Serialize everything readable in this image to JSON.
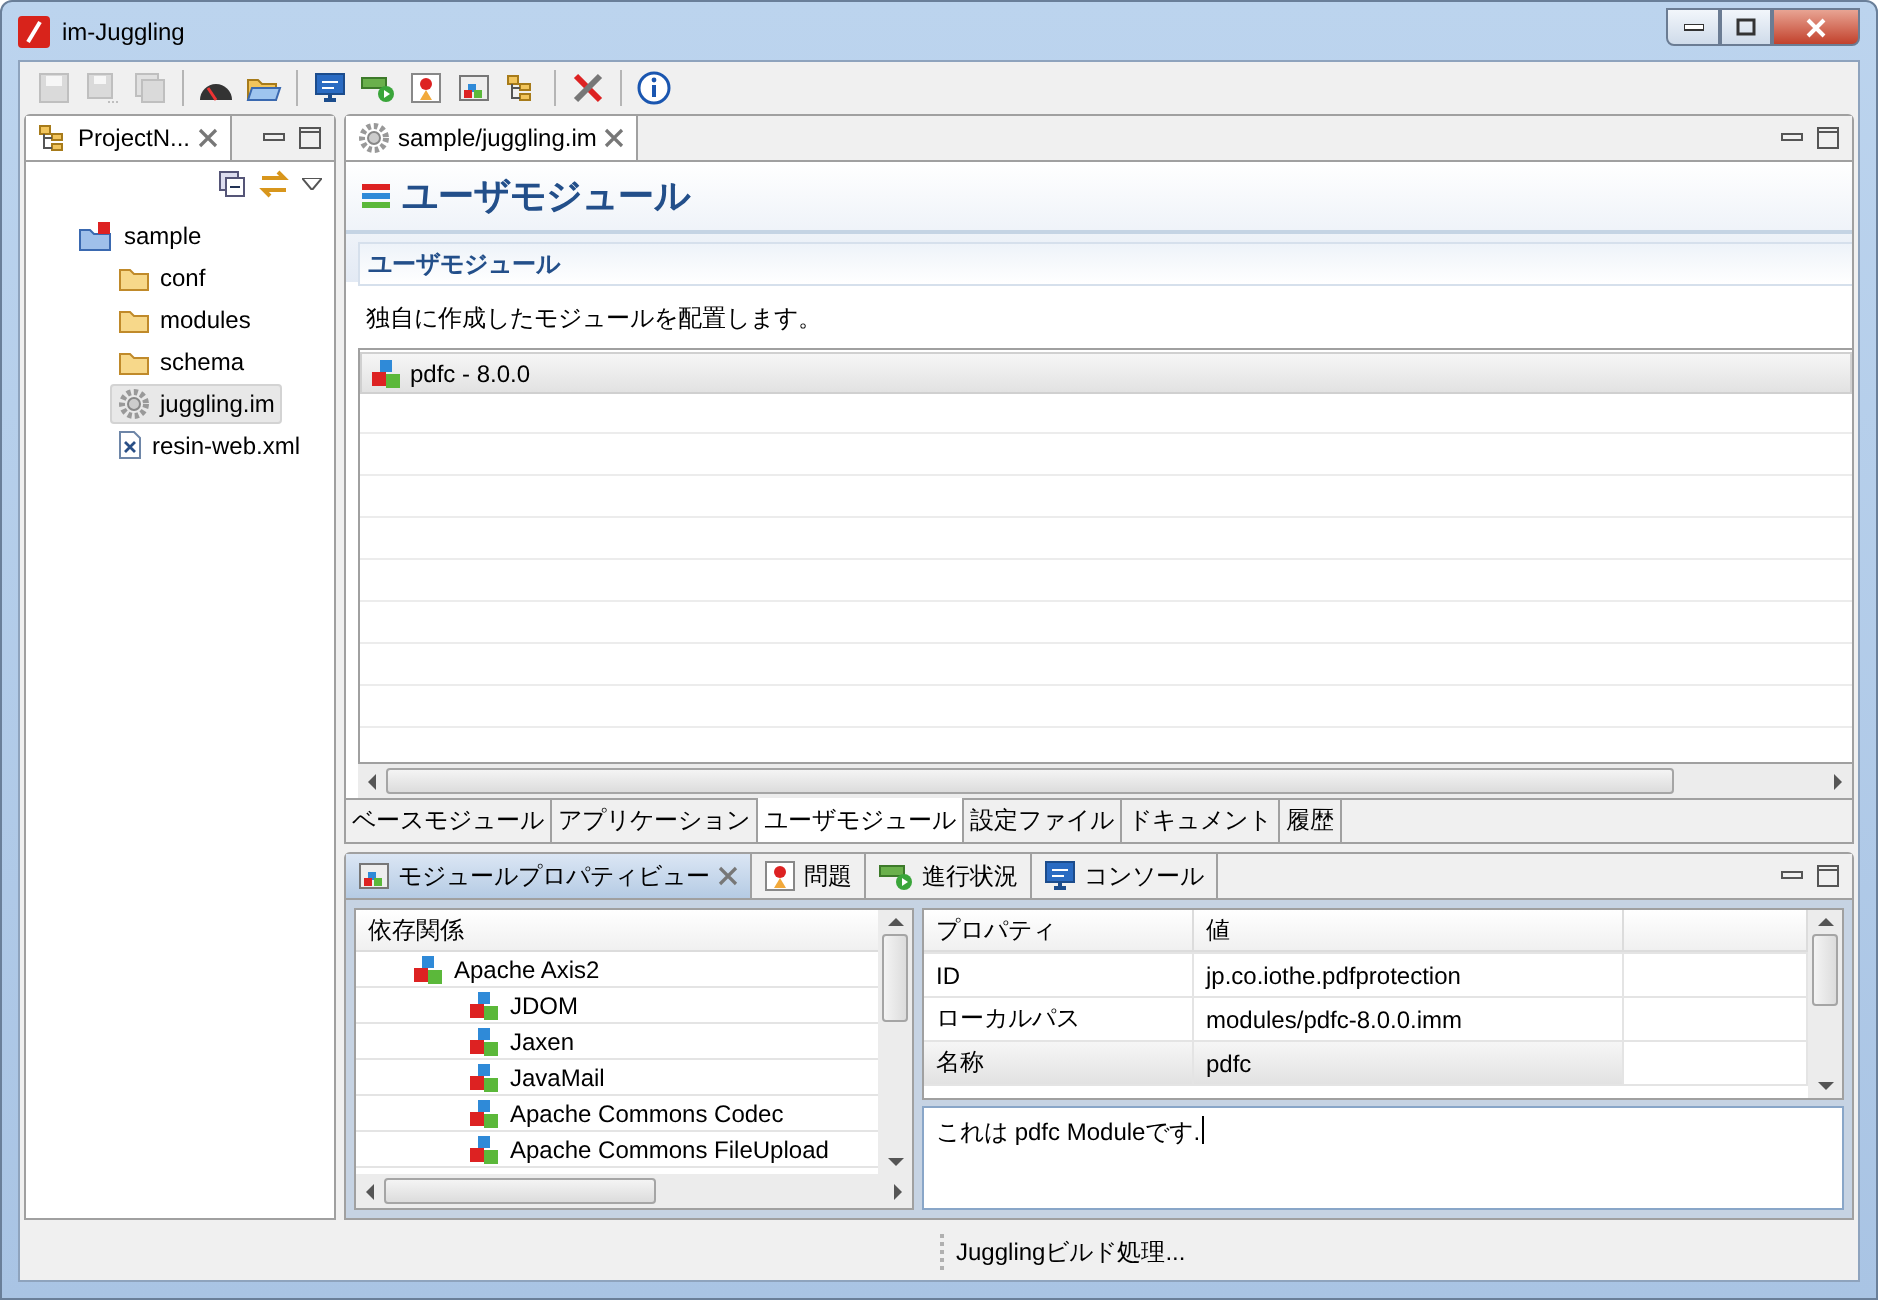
{
  "window": {
    "title": "im-Juggling"
  },
  "toolbar": [
    {
      "kind": "save",
      "disabled": true
    },
    {
      "kind": "save-as",
      "disabled": true
    },
    {
      "kind": "save-all",
      "disabled": true
    },
    {
      "kind": "gauge",
      "disabled": false
    },
    {
      "kind": "open-folder",
      "disabled": false
    },
    {
      "kind": "monitor",
      "disabled": false
    },
    {
      "kind": "run",
      "disabled": false
    },
    {
      "kind": "report",
      "disabled": false
    },
    {
      "kind": "window",
      "disabled": false
    },
    {
      "kind": "tree",
      "disabled": false
    },
    {
      "kind": "tools",
      "disabled": false
    },
    {
      "kind": "info",
      "disabled": false
    }
  ],
  "project_panel": {
    "tab": "ProjectN...",
    "tree": [
      {
        "label": "sample",
        "kind": "project",
        "selected": false,
        "children": [
          {
            "label": "conf",
            "kind": "folder",
            "selected": false
          },
          {
            "label": "modules",
            "kind": "folder",
            "selected": false
          },
          {
            "label": "schema",
            "kind": "folder",
            "selected": false
          },
          {
            "label": "juggling.im",
            "kind": "config",
            "selected": true
          },
          {
            "label": "resin-web.xml",
            "kind": "xml",
            "selected": false
          }
        ]
      }
    ]
  },
  "editor": {
    "tab": "sample/juggling.im",
    "heading": "ユーザモジュール",
    "section_title": "ユーザモジュール",
    "description": "独自に作成したモジュールを配置します。",
    "modules": [
      {
        "label": "pdfc - 8.0.0",
        "selected": true
      }
    ],
    "page_tabs": [
      {
        "label": "ベースモジュール",
        "selected": false
      },
      {
        "label": "アプリケーション",
        "selected": false
      },
      {
        "label": "ユーザモジュール",
        "selected": true
      },
      {
        "label": "設定ファイル",
        "selected": false
      },
      {
        "label": "ドキュメント",
        "selected": false
      },
      {
        "label": "履歴",
        "selected": false
      }
    ]
  },
  "bottom_panel": {
    "tabs": [
      {
        "label": "モジュールプロパティビュー",
        "kind": "module",
        "selected": true
      },
      {
        "label": "問題",
        "kind": "report",
        "selected": false
      },
      {
        "label": "進行状況",
        "kind": "run",
        "selected": false
      },
      {
        "label": "コンソール",
        "kind": "monitor",
        "selected": false
      }
    ],
    "dependencies": {
      "header": "依存関係",
      "tree": [
        {
          "label": "Apache Axis2",
          "children": [
            {
              "label": "JDOM"
            },
            {
              "label": "Jaxen"
            },
            {
              "label": "JavaMail"
            },
            {
              "label": "Apache Commons Codec"
            },
            {
              "label": "Apache Commons FileUpload"
            }
          ]
        }
      ]
    },
    "properties": {
      "columns": [
        "プロパティ",
        "値"
      ],
      "rows": [
        {
          "name": "ID",
          "value": "jp.co.iothe.pdfprotection",
          "selected": false
        },
        {
          "name": "ローカルパス",
          "value": "modules/pdfc-8.0.0.imm",
          "selected": false
        },
        {
          "name": "名称",
          "value": "pdfc",
          "selected": true
        }
      ]
    },
    "description": "これは pdfc Moduleです."
  },
  "status_bar": {
    "text": "Jugglingビルド処理..."
  }
}
